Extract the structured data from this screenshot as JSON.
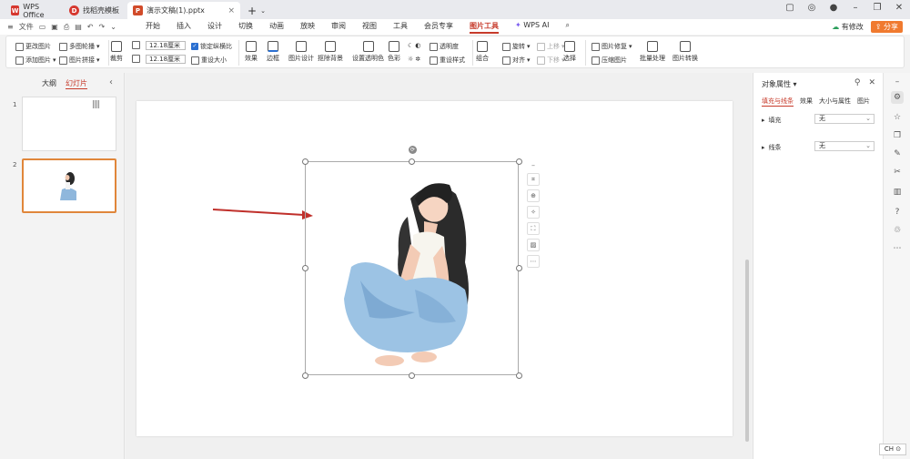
{
  "titlebar": {
    "tabs": [
      {
        "label": "WPS Office",
        "icon": "wps-icon",
        "color": "#d6382f"
      },
      {
        "label": "找稻壳模板",
        "icon": "docer-icon",
        "color": "#d6382f"
      },
      {
        "label": "演示文稿(1).pptx",
        "icon": "ppt-icon",
        "color": "#d14b2a"
      }
    ],
    "new_tab": "+"
  },
  "menubar": {
    "file_label": "文件",
    "menus": [
      "开始",
      "插入",
      "设计",
      "切换",
      "动画",
      "放映",
      "审阅",
      "视图",
      "工具",
      "会员专享",
      "图片工具"
    ],
    "active_menu": "图片工具",
    "wps_ai": "WPS AI",
    "edit_label": "有修改",
    "share_label": "分享"
  },
  "ribbon": {
    "change_pic": "更改图片",
    "multi_outline": "多图轮播",
    "add_pic": "添加图片",
    "pic_merge": "图片拼接",
    "crop": "裁剪",
    "width_value": "12.18厘米",
    "height_value": "12.18厘米",
    "lock_ratio": "锁定纵横比",
    "reset_size": "重设大小",
    "effect": "效果",
    "border": "边框",
    "pic_design": "图片设计",
    "remove_bg": "抠除背景",
    "set_transparent": "设置透明色",
    "color": "色彩",
    "transparency": "透明度",
    "reset_style": "重设样式",
    "combine": "组合",
    "rotate": "旋转",
    "align": "对齐",
    "bring_up": "上移",
    "send_down": "下移",
    "select": "选择",
    "pic_repair": "图片修复",
    "compress": "压缩图片",
    "batch": "批量处理",
    "convert": "图片转换"
  },
  "leftpane": {
    "tab_outline": "大纲",
    "tab_slides": "幻灯片",
    "slides": [
      {
        "num": "1"
      },
      {
        "num": "2"
      }
    ]
  },
  "properties": {
    "title": "对象属性",
    "tabs": [
      "填充与线条",
      "效果",
      "大小与属性",
      "图片"
    ],
    "fill_label": "填充",
    "fill_value": "无",
    "line_label": "线条",
    "line_value": "无"
  },
  "status": {
    "ime": "CH"
  },
  "colors": {
    "accent": "#c73b2b",
    "share": "#f07a2f",
    "selection": "#e0863a",
    "arrow": "#c0302b"
  }
}
